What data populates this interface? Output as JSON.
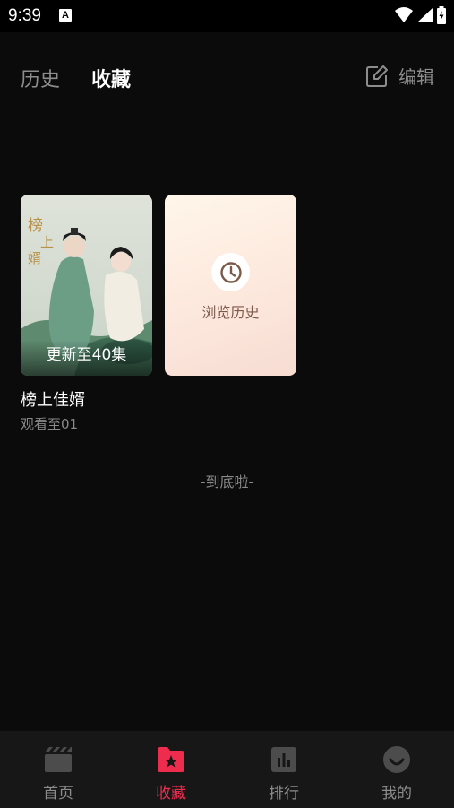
{
  "status_bar": {
    "time": "9:39",
    "notification_icon": "A"
  },
  "header": {
    "tabs": [
      {
        "label": "历史",
        "active": false
      },
      {
        "label": "收藏",
        "active": true
      }
    ],
    "edit_label": "编辑"
  },
  "favorites": {
    "items": [
      {
        "poster_title_art": "榜上佳婿",
        "badge": "更新至40集",
        "title": "榜上佳婿",
        "progress": "观看至01"
      }
    ],
    "history_card_label": "浏览历史"
  },
  "end_text": "-到底啦-",
  "bottom_nav": {
    "items": [
      {
        "label": "首页",
        "icon": "clapperboard-icon",
        "active": false
      },
      {
        "label": "收藏",
        "icon": "star-folder-icon",
        "active": true
      },
      {
        "label": "排行",
        "icon": "ranking-chart-icon",
        "active": false
      },
      {
        "label": "我的",
        "icon": "smile-face-icon",
        "active": false
      }
    ]
  },
  "colors": {
    "accent": "#ee2d4e",
    "background": "#0c0b0c",
    "muted": "#8e8d8d"
  }
}
